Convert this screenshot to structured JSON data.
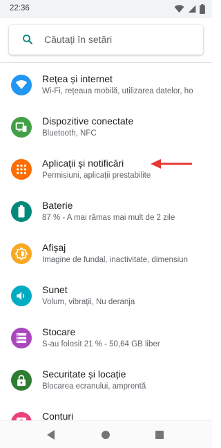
{
  "status_bar": {
    "time": "22:36",
    "icons": [
      "wifi-icon",
      "signal-icon",
      "battery-icon"
    ]
  },
  "search": {
    "placeholder": "Căutați în setări",
    "icon": "search-icon"
  },
  "settings": [
    {
      "id": "network",
      "title": "Rețea și internet",
      "subtitle": "Wi-Fi, rețeaua mobilă, utilizarea datelor, ho",
      "icon": "wifi-icon",
      "color": "#2196f3"
    },
    {
      "id": "devices",
      "title": "Dispozitive conectate",
      "subtitle": "Bluetooth, NFC",
      "icon": "devices-icon",
      "color": "#43a047"
    },
    {
      "id": "apps",
      "title": "Aplicații și notificări",
      "subtitle": "Permisiuni, aplicații prestabilite",
      "icon": "apps-grid-icon",
      "color": "#ff6d00"
    },
    {
      "id": "battery",
      "title": "Baterie",
      "subtitle": "87 % - A mai rămas mai mult de 2 zile",
      "icon": "battery-icon",
      "color": "#00897b"
    },
    {
      "id": "display",
      "title": "Afișaj",
      "subtitle": "Imagine de fundal, inactivitate, dimensiun",
      "icon": "brightness-icon",
      "color": "#f9a825"
    },
    {
      "id": "sound",
      "title": "Sunet",
      "subtitle": "Volum, vibrații, Nu deranja",
      "icon": "volume-icon",
      "color": "#00acc1"
    },
    {
      "id": "storage",
      "title": "Stocare",
      "subtitle": "S-au folosit 21 % - 50,64 GB liber",
      "icon": "storage-icon",
      "color": "#ab47bc"
    },
    {
      "id": "security",
      "title": "Securitate și locație",
      "subtitle": "Blocarea ecranului, amprentă",
      "icon": "lock-icon",
      "color": "#2e7d32"
    },
    {
      "id": "accounts",
      "title": "Conturi",
      "subtitle": "",
      "icon": "account-icon",
      "color": "#ec407a"
    }
  ],
  "annotation": {
    "arrow_color": "#e53935",
    "points_to": "apps"
  },
  "nav_bar": {
    "buttons": [
      "back-icon",
      "home-icon",
      "recents-icon"
    ]
  }
}
